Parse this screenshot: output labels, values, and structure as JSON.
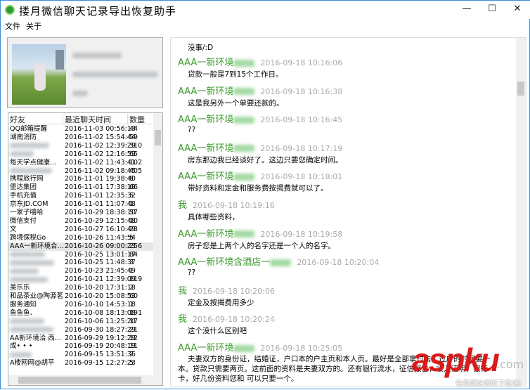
{
  "window": {
    "title": "搂月微信聊天记录导出恢复助手",
    "minimize": "—",
    "maximize": "☐",
    "close": "✕"
  },
  "menu": [
    "文件",
    "关于"
  ],
  "friends": {
    "headers": [
      "好友",
      "最近聊天时间",
      "数量"
    ],
    "rows": [
      {
        "name": "QQ邮箱提醒",
        "time": "2016-11-03 00:56:13",
        "count": "44"
      },
      {
        "name": "湖南消防",
        "time": "2016-11-02 15:54:44",
        "count": "59"
      },
      {
        "name": "",
        "time": "2016-11-02 12:39:29",
        "count": "310"
      },
      {
        "name": "",
        "time": "2016-11-02 12:16:59",
        "count": "65"
      },
      {
        "name": "每天学点健康...",
        "time": "2016-11-02 11:43:41",
        "count": "102"
      },
      {
        "name": "",
        "time": "2016-11-02 09:18:45",
        "count": "405"
      },
      {
        "name": "携程旅行网",
        "time": "2016-11-01 19:38:40",
        "count": "8"
      },
      {
        "name": "堡达集团",
        "time": "2016-11-01 17:38:18",
        "count": "66"
      },
      {
        "name": "手机充值",
        "time": "2016-11-01 12:35:32",
        "count": "5"
      },
      {
        "name": "京东JD.COM",
        "time": "2016-11-01 11:07:48",
        "count": "1"
      },
      {
        "name": "一家子嘻哈",
        "time": "2016-10-29 18:38:10",
        "count": "57"
      },
      {
        "name": "微信支付",
        "time": "2016-10-29 12:15:48",
        "count": "10"
      },
      {
        "name": "文",
        "time": "2016-10-27 16:10:49",
        "count": "23"
      },
      {
        "name": "跨境保税Go",
        "time": "2016-10-26 11:43:54",
        "count": "5"
      },
      {
        "name": "AAA一新环境合...",
        "time": "2016-10-26 09:00:23",
        "count": "256"
      },
      {
        "name": "",
        "time": "2016-10-25 13:01:17",
        "count": "84"
      },
      {
        "name": "",
        "time": "2016-10-25 11:48:37",
        "count": "3"
      },
      {
        "name": "",
        "time": "2016-10-23 21:45:49",
        "count": "1"
      },
      {
        "name": "",
        "time": "2016-10-21 12:39:09",
        "count": "119"
      },
      {
        "name": "美乐乐",
        "time": "2016-10-20 17:31:18",
        "count": "2"
      },
      {
        "name": "和品茶业@陶源茗",
        "time": "2016-10-20 15:08:53",
        "count": "60"
      },
      {
        "name": "服务通知",
        "time": "2016-10-10 14:53:18",
        "count": "1"
      },
      {
        "name": "鱼鱼鱼、",
        "time": "2016-10-08 18:13:08",
        "count": "191"
      },
      {
        "name": "",
        "time": "2016-10-06 11:25:20",
        "count": "17"
      },
      {
        "name": "",
        "time": "2016-09-30 18:27:29",
        "count": "21"
      },
      {
        "name": "AA新环境洽 西...",
        "time": "2016-09-29 19:12:29",
        "count": "12"
      },
      {
        "name": "成• • •",
        "time": "2016-09-19 20:48:19",
        "count": "11"
      },
      {
        "name": "",
        "time": "2016-09-15 13:51:36",
        "count": "7"
      },
      {
        "name": "A楼网网@胡平",
        "time": "2016-09-15 12:27:23",
        "count": "5"
      }
    ]
  },
  "chat": {
    "first_text": "没事/:D",
    "messages": [
      {
        "sender": "AAA一新环境",
        "time": "2016-09-18 10:16:06",
        "text": "贷款一般是7到15个工作日。"
      },
      {
        "sender": "AAA一新环境",
        "time": "2016-09-18 10:16:38",
        "text": "这是我另外一个单要还款的。"
      },
      {
        "sender": "AAA一新环境",
        "time": "2016-09-18 10:16:45",
        "text": "??"
      },
      {
        "sender": "AAA一新环境",
        "time": "2016-09-18 10:17:19",
        "text": "房东那边我已经谈好了。这边只要您确定时间。"
      },
      {
        "sender": "AAA一新环境",
        "time": "2016-09-18 10:18:01",
        "text": "带好资料和定金和服务费按揭费就可以了。"
      },
      {
        "sender": "我",
        "time": "2016-09-18 10:19:16",
        "text": "具体哪些资料，"
      },
      {
        "sender": "AAA一新环境",
        "time": "2016-09-18 10:19:58",
        "text": "房子您是上两个人的名字还是一个人的名字。"
      },
      {
        "sender": "AAA一新环境含酒店一",
        "time": "2016-09-18 10:20:04",
        "text": "??"
      },
      {
        "sender": "我",
        "time": "2016-09-18 10:20:06",
        "text": "定金及按揭费用多少"
      },
      {
        "sender": "我",
        "time": "2016-09-18 10:20:24",
        "text": "这个没什么区别吧"
      },
      {
        "sender": "AAA一新环境",
        "time": "2016-09-18 10:25:05",
        "text": "夫妻双方的身份证，结婚证，户口本的户主页和本人页。最好是全部拿过去，过户的时候要一本。贷款只需要两页。这前面的资料是夫妻双方的。还有银行流水，征信报告，收入证明，银行卡，好几份资料您和 可以只要一个。"
      }
    ]
  },
  "watermark": {
    "logo": "aspku",
    "domain": ".com",
    "sub": "免费网站源码下载站!"
  },
  "colors": {
    "sender": "#3a9a2a",
    "timestamp": "#aaaaaa",
    "watermark": "#d91b1b"
  }
}
